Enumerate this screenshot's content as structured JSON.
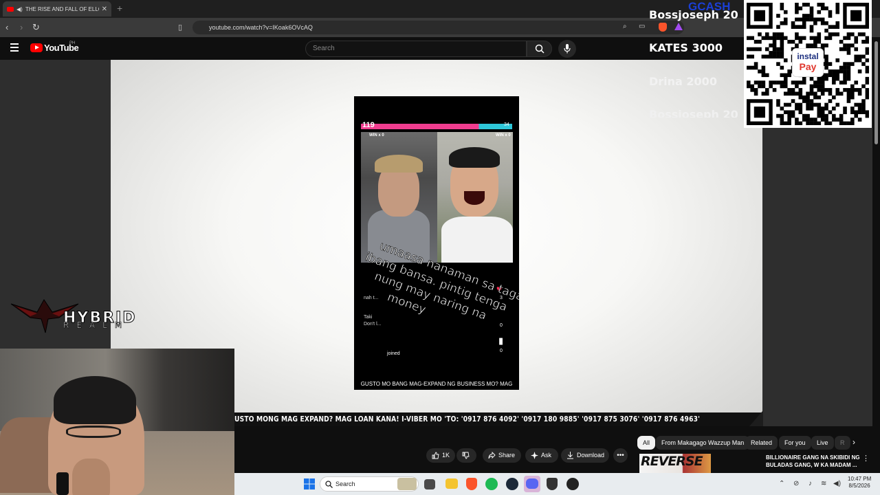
{
  "browser": {
    "tab_title": "THE RISE AND FALL OF ELLO",
    "new_tab": "+",
    "url": "youtube.com/watch?v=IKoak6OVcAQ"
  },
  "youtube": {
    "logo_text": "YouTube",
    "country": "PH",
    "search_placeholder": "Search"
  },
  "video": {
    "phone_top_left": "119",
    "phone_top_right": "34",
    "win_left": "WIN x 0",
    "win_right": "WIN x 0",
    "overlay_lines": [
      "umaasa nanaman sa taga",
      "ibang bansa. pintig tenga",
      "nung may naring na",
      "money"
    ],
    "heart_count": "3",
    "comment_count": "0",
    "bookmark_count": "0",
    "comment_1": "nah t...",
    "comment_2": "Taki",
    "comment_3": "Don't l...",
    "joined": "joined",
    "phone_caption": "GUSTO MO BANG MAG-EXPAND NG BUSINESS MO? MAG"
  },
  "ticker": "USTO MONG MAG EXPAND? MAG LOAN KANA! I-VIBER MO 'TO: '0917 876 4092' '0917 180 9885' '0917 875 3076' '0917 876 4963'",
  "donations": [
    {
      "text": "Bossjoseph 20",
      "color": "#ffffff"
    },
    {
      "text": "KATES 3000",
      "color": "#ffffff"
    },
    {
      "text": "Drina 2000",
      "color": "#f2f2f2"
    },
    {
      "text": "Bossjoseph 20",
      "color": "#f0f0f0"
    }
  ],
  "gcash": "GCASH",
  "instapay": {
    "top": "instal",
    "bottom": "Pay"
  },
  "hybrid_realm": {
    "line1": "HYBRID",
    "line2": "REALM"
  },
  "actions": {
    "like_count": "1K",
    "share": "Share",
    "ask": "Ask",
    "download": "Download"
  },
  "chips": [
    "All",
    "From Makagago Wazzup Man",
    "Related",
    "For you",
    "Live",
    "R"
  ],
  "recommended": {
    "thumb_text": "REVERSE",
    "title": "BILLIONAIRE GANG NA SKIBIDI NG BULADAS GANG, W KA MADAM ..."
  },
  "taskbar": {
    "search": "Search",
    "time": "10:47 PM",
    "date": "8/5/2026"
  }
}
